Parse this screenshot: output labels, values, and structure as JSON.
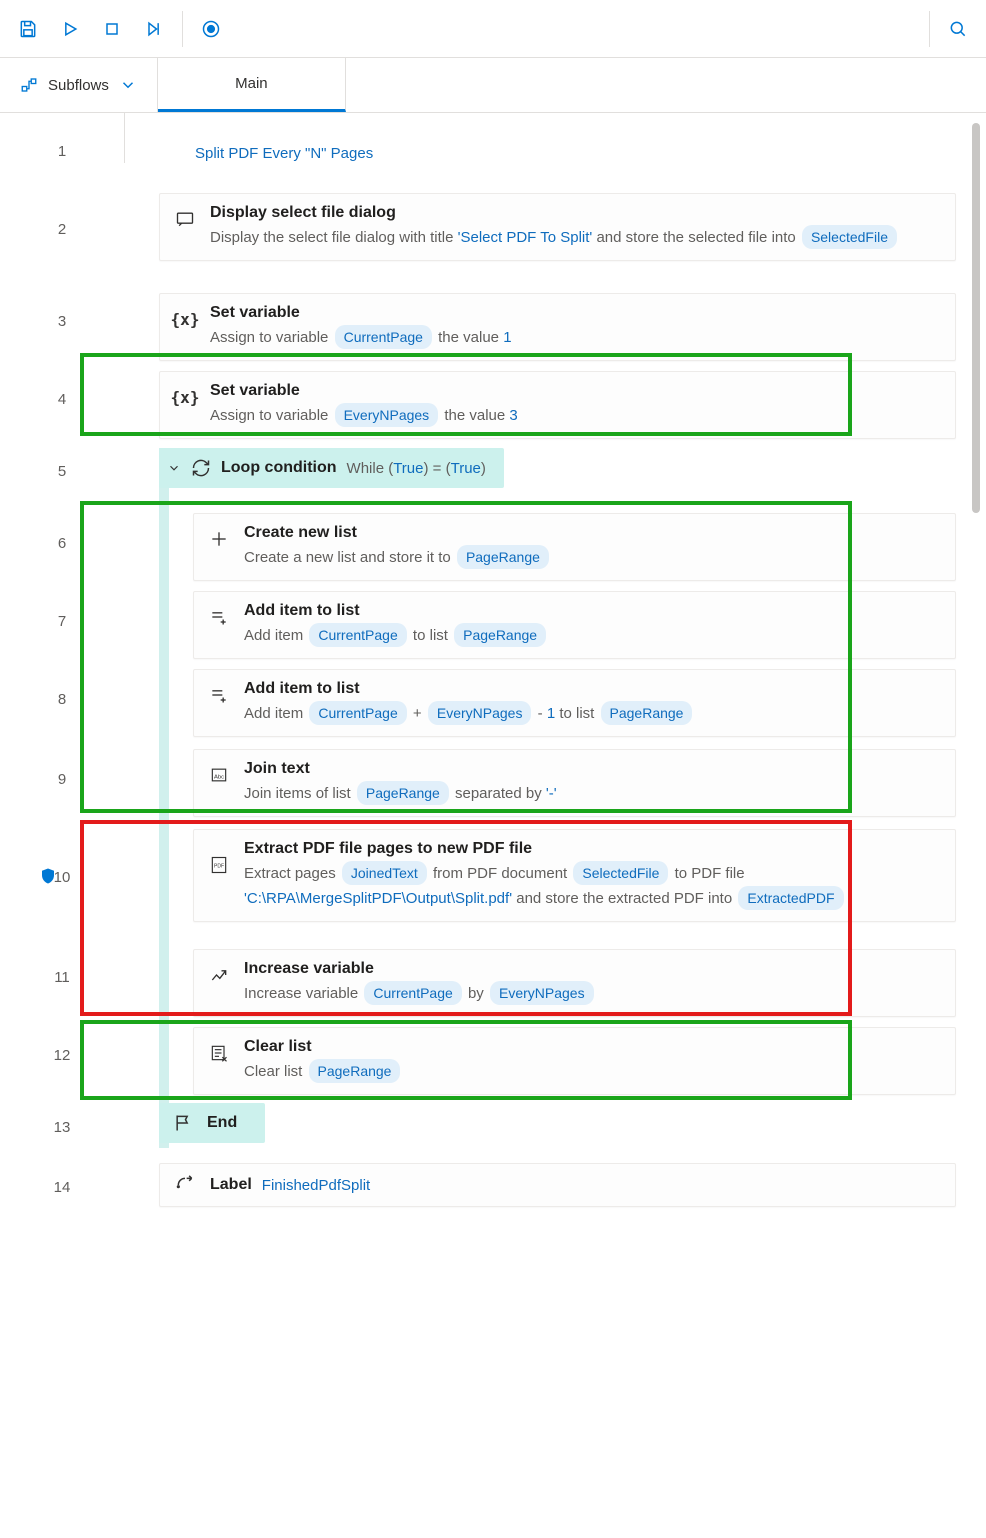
{
  "toolbar": {
    "save": "Save",
    "run": "Run",
    "stop": "Stop",
    "next": "Run next action",
    "record": "Recorder",
    "search": "Search"
  },
  "tabs": {
    "subflows_label": "Subflows",
    "main_tab": "Main"
  },
  "comment": "Split PDF Every \"N\" Pages",
  "lines": [
    "1",
    "2",
    "3",
    "4",
    "5",
    "6",
    "7",
    "8",
    "9",
    "10",
    "11",
    "12",
    "13",
    "14"
  ],
  "action2": {
    "title": "Display select file dialog",
    "d1": "Display the select file dialog with title ",
    "s1": "'Select PDF To Split'",
    "d2": " and store the selected file into ",
    "v1": "SelectedFile"
  },
  "action3": {
    "title": "Set variable",
    "d1": "Assign to variable ",
    "v1": "CurrentPage",
    "d2": " the value ",
    "val": "1"
  },
  "action4": {
    "title": "Set variable",
    "d1": "Assign to variable ",
    "v1": "EveryNPages",
    "d2": " the value ",
    "val": "3"
  },
  "action5": {
    "title": "Loop condition",
    "d1": "While (",
    "v1": "True",
    "d2": ") = (",
    "v2": "True",
    "d3": ")"
  },
  "action6": {
    "title": "Create new list",
    "d1": "Create a new list and store it to ",
    "v1": "PageRange"
  },
  "action7": {
    "title": "Add item to list",
    "d1": "Add item ",
    "v1": "CurrentPage",
    "d2": " to list ",
    "v2": "PageRange"
  },
  "action8": {
    "title": "Add item to list",
    "d1": "Add item ",
    "v1": "CurrentPage",
    "d2": " + ",
    "v2": "EveryNPages",
    "d3": " - ",
    "val": "1",
    "d4": " to list ",
    "v3": "PageRange"
  },
  "action9": {
    "title": "Join text",
    "d1": "Join items of list ",
    "v1": "PageRange",
    "d2": " separated by ",
    "s1": "'-'"
  },
  "action10": {
    "title": "Extract PDF file pages to new PDF file",
    "d1": "Extract pages ",
    "v1": "JoinedText",
    "d2": " from PDF document ",
    "v2": "SelectedFile",
    "d3": " to PDF file ",
    "s1": "'C:\\RPA\\MergeSplitPDF\\Output\\Split.pdf'",
    "d4": " and store the extracted PDF into ",
    "v3": "ExtractedPDF"
  },
  "action11": {
    "title": "Increase variable",
    "d1": "Increase variable ",
    "v1": "CurrentPage",
    "d2": " by ",
    "v2": "EveryNPages"
  },
  "action12": {
    "title": "Clear list",
    "d1": "Clear list ",
    "v1": "PageRange"
  },
  "action13": {
    "title": "End"
  },
  "action14": {
    "title": "Label",
    "v1": "FinishedPdfSplit"
  }
}
